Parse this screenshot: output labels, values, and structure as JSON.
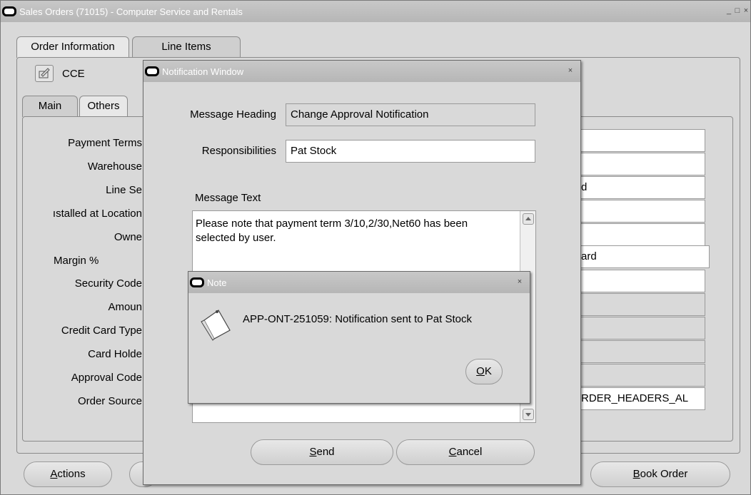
{
  "main_window": {
    "title": "Sales Orders (71015) - Computer Service and Rentals",
    "win_buttons": [
      "_",
      "□",
      "×"
    ],
    "tabs": [
      {
        "label": "Order Information"
      },
      {
        "label": "Line Items"
      }
    ],
    "customer_short": "CCE",
    "subtabs": [
      {
        "label": "Main"
      },
      {
        "label": "Others"
      }
    ],
    "labels": [
      "Payment Terms",
      "Warehouse",
      "Line Se",
      "ıstalled at Location",
      "Owne",
      "Margin %",
      "Security Code",
      "Amoun",
      "Credit Card Type",
      "Card Holde",
      "Approval Code",
      "Order Source"
    ],
    "right_values": [
      "",
      "",
      "d",
      "",
      "",
      "ard",
      "",
      "",
      "",
      "",
      "",
      "RDER_HEADERS_AL"
    ],
    "bottom_buttons": {
      "actions": {
        "before": "",
        "mn": "A",
        "after": "ctions"
      },
      "book": {
        "before": "",
        "mn": "B",
        "after": "ook Order"
      }
    }
  },
  "notification": {
    "title": "Notification Window",
    "close": "×",
    "heading_label": "Message Heading",
    "heading_value": "Change Approval Notification",
    "resp_label": "Responsibilities",
    "resp_value": "Pat Stock",
    "text_label": "Message Text",
    "text_value": "Please note that payment term 3/10,2/30,Net60 has been selected by user.",
    "send": {
      "before": "",
      "mn": "S",
      "after": "end"
    },
    "cancel": {
      "before": "",
      "mn": "C",
      "after": "ancel"
    }
  },
  "note": {
    "title": "Note",
    "close": "×",
    "message": "APP-ONT-251059: Notification sent to Pat Stock",
    "ok": {
      "before": "",
      "mn": "O",
      "after": "K"
    }
  }
}
